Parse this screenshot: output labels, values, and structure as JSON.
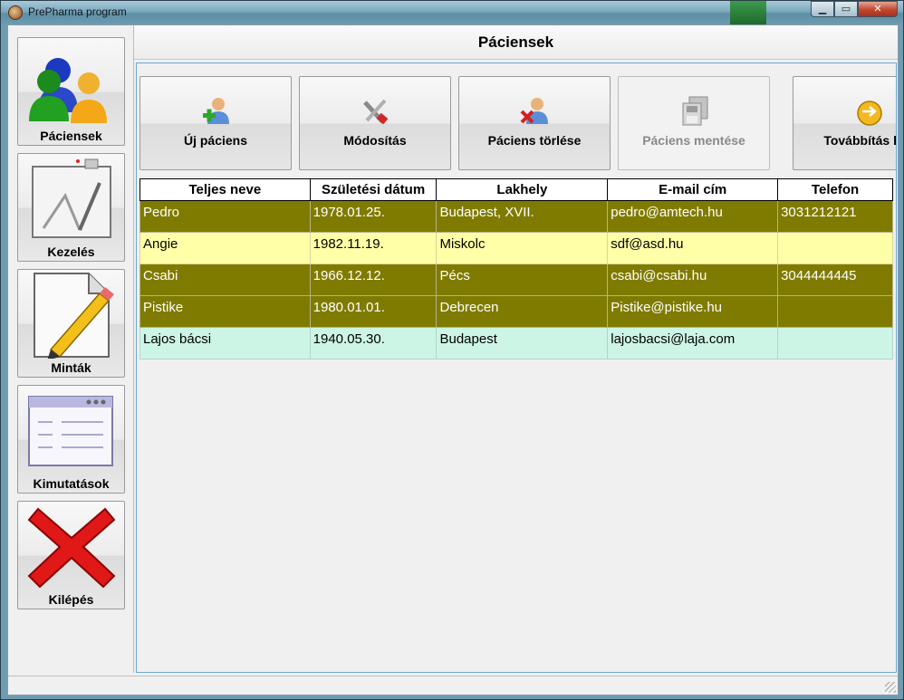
{
  "window": {
    "title": "PrePharma program"
  },
  "sidebar": {
    "items": [
      {
        "label": "Páciensek",
        "icon": "patients-icon"
      },
      {
        "label": "Kezelés",
        "icon": "treatment-board-icon"
      },
      {
        "label": "Minták",
        "icon": "pencil-paper-icon"
      },
      {
        "label": "Kimutatások",
        "icon": "report-window-icon"
      },
      {
        "label": "Kilépés",
        "icon": "exit-x-icon"
      }
    ]
  },
  "header": {
    "title": "Páciensek"
  },
  "toolbar": {
    "buttons": [
      {
        "label": "Új páciens",
        "icon": "add-user-icon",
        "enabled": true
      },
      {
        "label": "Módosítás",
        "icon": "tools-icon",
        "enabled": true
      },
      {
        "label": "Páciens törlése",
        "icon": "delete-user-icon",
        "enabled": true
      },
      {
        "label": "Páciens mentése",
        "icon": "save-copy-icon",
        "enabled": false
      },
      {
        "label": "Továbbítás kez",
        "icon": "forward-icon",
        "enabled": true
      }
    ]
  },
  "table": {
    "columns": [
      "Teljes neve",
      "Születési dátum",
      "Lakhely",
      "E-mail cím",
      "Telefon"
    ],
    "rows": [
      {
        "name": "Pedro",
        "birth": "1978.01.25.",
        "city": "Budapest, XVII.",
        "email": "pedro@amtech.hu",
        "phone": "3031212121"
      },
      {
        "name": "Angie",
        "birth": "1982.11.19.",
        "city": "Miskolc",
        "email": "sdf@asd.hu",
        "phone": ""
      },
      {
        "name": "Csabi",
        "birth": "1966.12.12.",
        "city": "Pécs",
        "email": "csabi@csabi.hu",
        "phone": "3044444445"
      },
      {
        "name": "Pistike",
        "birth": "1980.01.01.",
        "city": "Debrecen",
        "email": "Pistike@pistike.hu",
        "phone": ""
      },
      {
        "name": "Lajos bácsi",
        "birth": "1940.05.30.",
        "city": "Budapest",
        "email": "lajosbacsi@laja.com",
        "phone": ""
      }
    ]
  },
  "colors": {
    "olive_row": "#7f7b00",
    "yellow_row": "#ffffa8",
    "mint_row": "#cdf5e6"
  }
}
